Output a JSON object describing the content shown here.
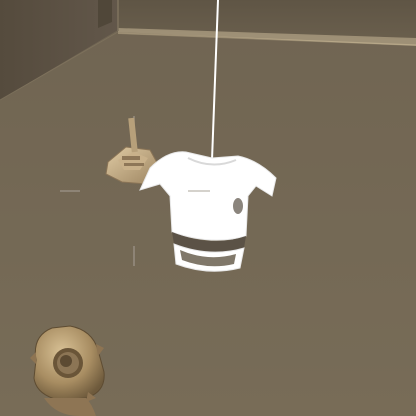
{
  "scene": {
    "environment": "interior-room",
    "held_object": "white-chest-armor",
    "hand_object": "tan-mechanical-claw",
    "secondary_object": "tan-gear-part",
    "tether": "white-rope",
    "crosshair": "dashed-crosshair"
  },
  "colors": {
    "wall_left": "#5b5142",
    "wall_back": "#6a5f4c",
    "floor": "#776a55",
    "ceiling_band": "#a89a7b",
    "armor": "#ffffff",
    "tan_object": "#b49a70",
    "crosshair": "#9a9288"
  }
}
